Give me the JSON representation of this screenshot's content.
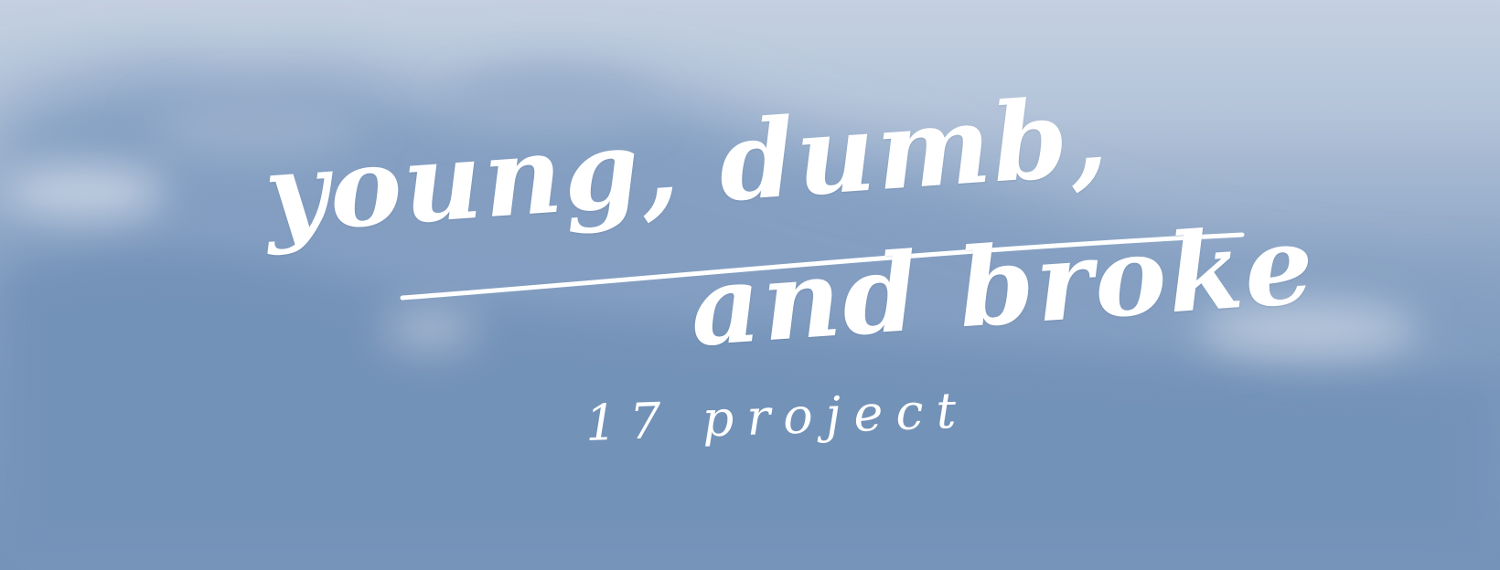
{
  "banner": {
    "title_line_1": "young, dumb,",
    "title_line_2": "and broke",
    "subtitle": "17 project"
  },
  "colors": {
    "sky_top": "#c3cfe0",
    "cloud_dark": "#6f8fb6",
    "cloud_light": "#a9bad2",
    "text": "#ffffff"
  }
}
